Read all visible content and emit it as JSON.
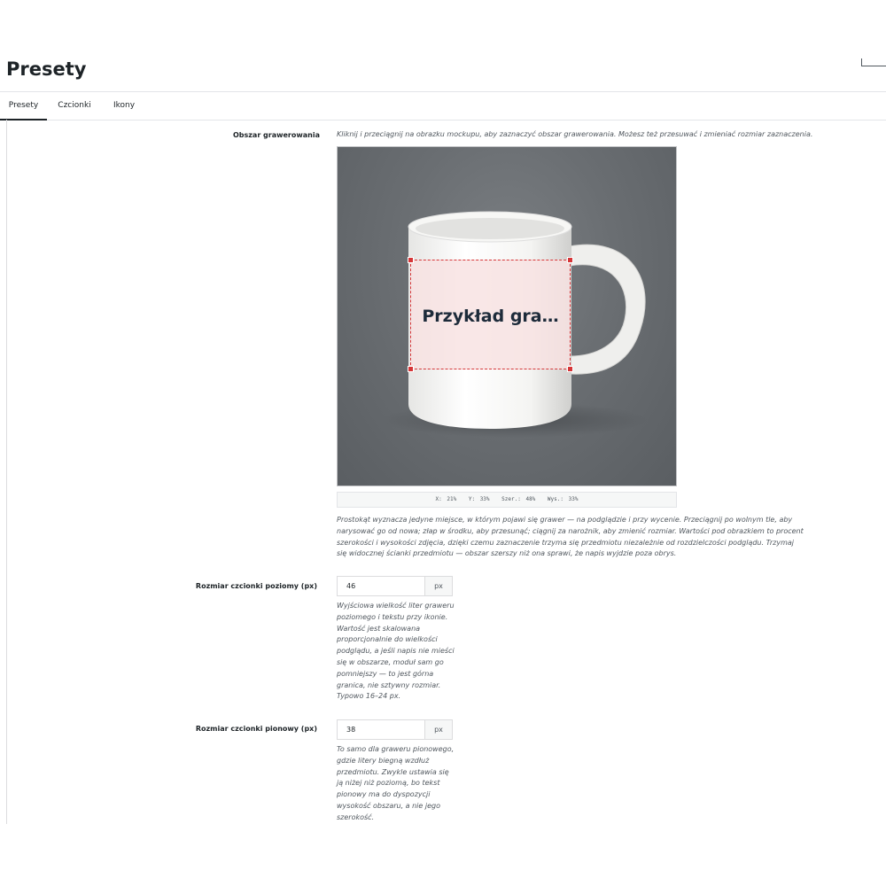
{
  "page": {
    "title": "Presety"
  },
  "tabs": [
    {
      "label": "Presety",
      "active": true
    },
    {
      "label": "Czcionki",
      "active": false
    },
    {
      "label": "Ikony",
      "active": false
    }
  ],
  "engrave_area": {
    "label": "Obszar grawerowania",
    "instruction": "Kliknij i przeciągnij na obrazku mockupu, aby zaznaczyć obszar grawerowania. Możesz też przesuwać i zmieniać rozmiar zaznaczenia.",
    "preview_text": "Przykład gra…",
    "readout": {
      "x": "X: 21%",
      "y": "Y: 33%",
      "width": "Szer.: 48%",
      "height": "Wys.: 33%"
    },
    "selection": {
      "x_percent": 21,
      "y_percent": 33,
      "width_percent": 48,
      "height_percent": 33
    },
    "help": "Prostokąt wyznacza jedyne miejsce, w którym pojawi się grawer — na podglądzie i przy wycenie. Przeciągnij po wolnym tle, aby narysować go od nowa; złap w środku, aby przesunąć; ciągnij za narożnik, aby zmienić rozmiar. Wartości pod obrazkiem to procent szerokości i wysokości zdjęcia, dzięki czemu zaznaczenie trzyma się przedmiotu niezależnie od rozdzielczości podglądu. Trzymaj się widocznej ścianki przedmiotu — obszar szerszy niż ona sprawi, że napis wyjdzie poza obrys."
  },
  "font_size_horizontal": {
    "label": "Rozmiar czcionki poziomy (px)",
    "value": "46",
    "unit": "px",
    "help": "Wyjściowa wielkość liter graweru poziomego i tekstu przy ikonie. Wartość jest skalowana proporcjonalnie do wielkości podglądu, a jeśli napis nie mieści się w obszarze, moduł sam go pomniejszy — to jest górna granica, nie sztywny rozmiar. Typowo 16–24 px."
  },
  "font_size_vertical": {
    "label": "Rozmiar czcionki pionowy (px)",
    "value": "38",
    "unit": "px",
    "help": "To samo dla graweru pionowego, gdzie litery biegną wzdłuż przedmiotu. Zwykle ustawia się ją niżej niż poziomą, bo tekst pionowy ma do dyspozycji wysokość obszaru, a nie jego szerokość."
  },
  "colors": {
    "accent": "#d63638",
    "text": "#1d2327",
    "muted": "#50575e",
    "border": "#dcdcde"
  }
}
